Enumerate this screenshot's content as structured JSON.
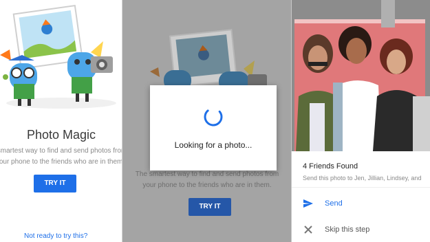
{
  "onboarding": {
    "title": "Photo Magic",
    "description_line1": "smartest way to find and send photos from",
    "description_line2": "our phone to the friends who are in them.",
    "try_button": "TRY IT",
    "not_ready_link": "Not ready to try this?"
  },
  "loading": {
    "dialog_text": "Looking for a photo...",
    "description_line1": "The smartest way to find and send photos from",
    "description_line2": "your phone to the friends who are in them.",
    "try_button": "TRY IT"
  },
  "results": {
    "title": "4 Friends Found",
    "subtitle": "Send this photo to Jen, Jillian, Lindsey, and",
    "send_label": "Send",
    "skip_label": "Skip this step"
  },
  "colors": {
    "accent": "#1e6fe8"
  },
  "icons": [
    "send-icon",
    "close-icon",
    "spinner-icon",
    "camera-icon"
  ]
}
